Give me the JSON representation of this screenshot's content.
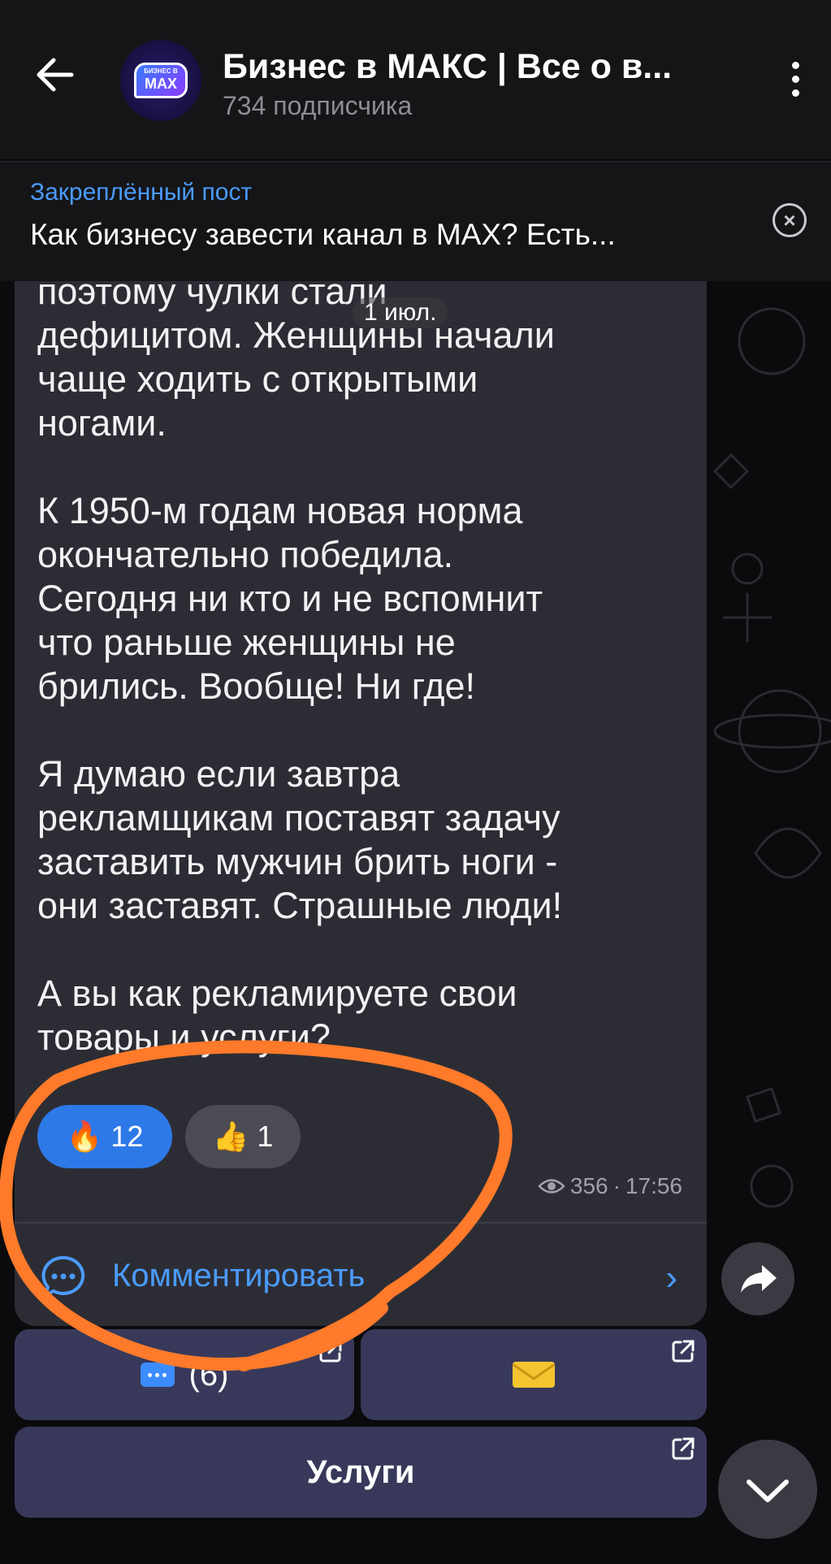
{
  "header": {
    "title": "Бизнес в МАКС | Все о в...",
    "subscribers": "734 подписчика",
    "avatar_small": "БИЗНЕС В",
    "avatar_big": "MAX"
  },
  "pinned": {
    "label": "Закреплённый пост",
    "text": "Как бизнесу завести канал в MAX? Есть..."
  },
  "message": {
    "date_chip": "1 июл.",
    "text": "поэтому чулки стали\nдефицитом. Женщины начали\nчаще ходить с открытыми\nногами.\n\nК 1950-м годам новая норма\nокончательно победила.\nСегодня ни кто и не вспомнит\nчто раньше женщины не\nбрились. Вообще! Ни где!\n\nЯ думаю если завтра\nрекламщикам поставят задачу\nзаставить мужчин брить ноги -\nони заставят. Страшные люди!\n\nА вы как рекламируете свои\nтовары и услуги?",
    "reactions": [
      {
        "emoji": "🔥",
        "count": "12"
      },
      {
        "emoji": "👍",
        "count": "1"
      }
    ],
    "views": "356",
    "time": "17:56",
    "comment_label": "Комментировать"
  },
  "buttons": {
    "comments_count": "(6)",
    "services": "Услуги"
  },
  "colors": {
    "accent": "#4b9bff",
    "annotation": "#ff7a2a",
    "bubble": "#2c2d34",
    "inline_button": "#38395a"
  }
}
